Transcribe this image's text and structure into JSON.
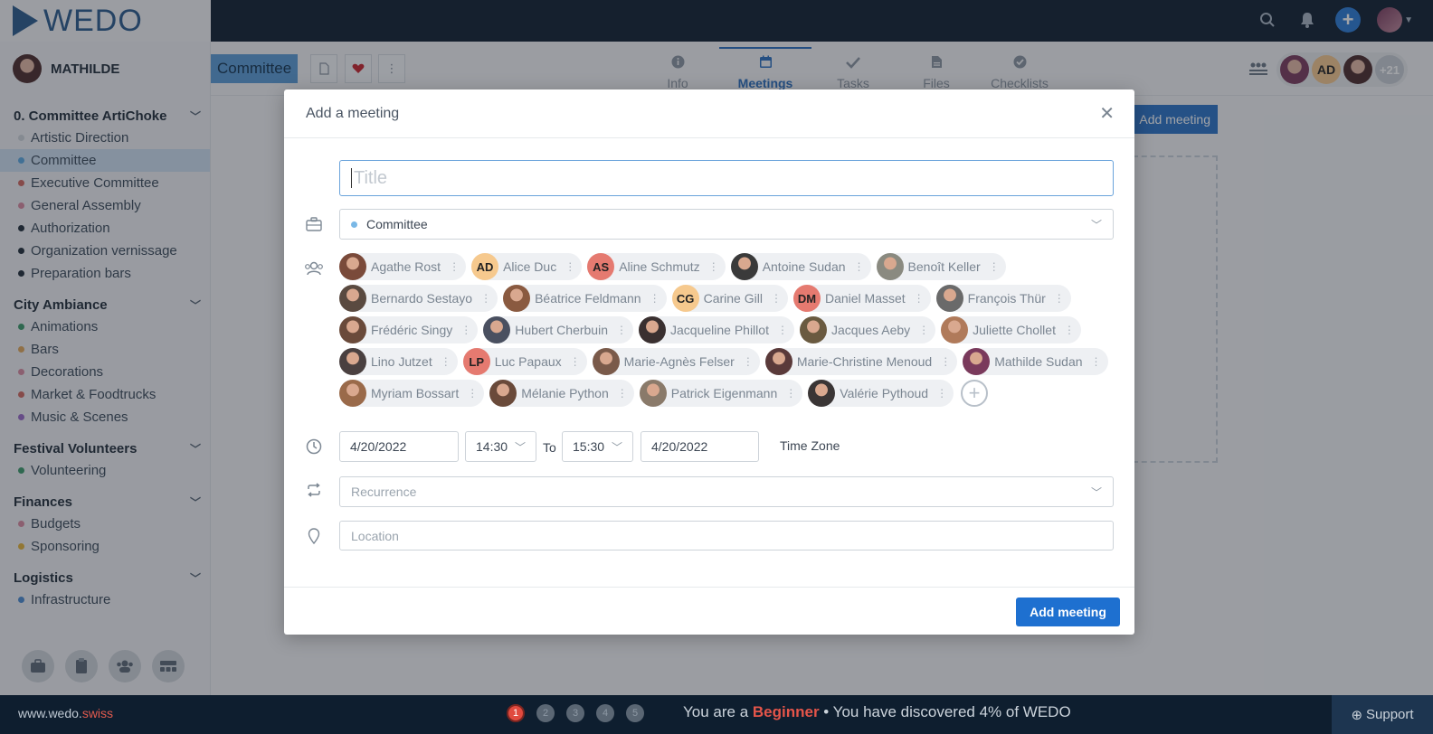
{
  "app": {
    "logo": "WEDO"
  },
  "user": {
    "name": "MATHILDE"
  },
  "sidebar": {
    "groups": [
      {
        "title": "0. Committee ArtiChoke",
        "items": [
          {
            "label": "Artistic Direction",
            "color": "#cfd4da"
          },
          {
            "label": "Committee",
            "color": "#5aa7e0",
            "active": true
          },
          {
            "label": "Executive Committee",
            "color": "#d0685f"
          },
          {
            "label": "General Assembly",
            "color": "#d98aa0"
          },
          {
            "label": "Authorization",
            "color": "#1f2b38"
          },
          {
            "label": "Organization vernissage",
            "color": "#1f2b38"
          },
          {
            "label": "Preparation bars",
            "color": "#1f2b38"
          }
        ]
      },
      {
        "title": "City Ambiance",
        "items": [
          {
            "label": "Animations",
            "color": "#3c9a6a"
          },
          {
            "label": "Bars",
            "color": "#e2a85a"
          },
          {
            "label": "Decorations",
            "color": "#d98aa0"
          },
          {
            "label": "Market & Foodtrucks",
            "color": "#d0685f"
          },
          {
            "label": "Music & Scenes",
            "color": "#9a6ac8"
          }
        ]
      },
      {
        "title": "Festival Volunteers",
        "items": [
          {
            "label": "Volunteering",
            "color": "#3c9a6a"
          }
        ]
      },
      {
        "title": "Finances",
        "items": [
          {
            "label": "Budgets",
            "color": "#d98aa0"
          },
          {
            "label": "Sponsoring",
            "color": "#e6b43a"
          }
        ]
      },
      {
        "title": "Logistics",
        "items": [
          {
            "label": "Infrastructure",
            "color": "#4a8ad0"
          }
        ]
      }
    ]
  },
  "header": {
    "workspace": "Committee",
    "tabs": [
      {
        "label": "Info",
        "icon": "info-icon"
      },
      {
        "label": "Meetings",
        "icon": "calendar-icon",
        "active": true
      },
      {
        "label": "Tasks",
        "icon": "check-icon"
      },
      {
        "label": "Files",
        "icon": "file-icon"
      },
      {
        "label": "Checklists",
        "icon": "checklist-icon"
      }
    ],
    "members_more": "+21",
    "member_initials": "AD"
  },
  "background": {
    "add_meeting_label": "Add meeting"
  },
  "modal": {
    "title": "Add a meeting",
    "title_placeholder": "Title",
    "workspace": "Committee",
    "participants": [
      {
        "name": "Agathe Rost",
        "initials": "",
        "color": "#7a4a3a"
      },
      {
        "name": "Alice Duc",
        "initials": "AD",
        "color": "#f6c98e"
      },
      {
        "name": "Aline Schmutz",
        "initials": "AS",
        "color": "#e57a70"
      },
      {
        "name": "Antoine Sudan",
        "initials": "",
        "color": "#3a3a3a"
      },
      {
        "name": "Benoît Keller",
        "initials": "",
        "color": "#8a8a80"
      },
      {
        "name": "Bernardo Sestayo",
        "initials": "",
        "color": "#5a4a40"
      },
      {
        "name": "Béatrice Feldmann",
        "initials": "",
        "color": "#8a5a40"
      },
      {
        "name": "Carine Gill",
        "initials": "CG",
        "color": "#f6c98e"
      },
      {
        "name": "Daniel Masset",
        "initials": "DM",
        "color": "#e57a70"
      },
      {
        "name": "François Thür",
        "initials": "",
        "color": "#6a6a6a"
      },
      {
        "name": "Frédéric Singy",
        "initials": "",
        "color": "#6a4a3a"
      },
      {
        "name": "Hubert Cherbuin",
        "initials": "",
        "color": "#4a5060"
      },
      {
        "name": "Jacqueline Phillot",
        "initials": "",
        "color": "#3a3030"
      },
      {
        "name": "Jacques Aeby",
        "initials": "",
        "color": "#6a5a40"
      },
      {
        "name": "Juliette Chollet",
        "initials": "",
        "color": "#b07a5a"
      },
      {
        "name": "Lino Jutzet",
        "initials": "",
        "color": "#4a4040"
      },
      {
        "name": "Luc Papaux",
        "initials": "LP",
        "color": "#e57a70"
      },
      {
        "name": "Marie-Agnès Felser",
        "initials": "",
        "color": "#7a5a4a"
      },
      {
        "name": "Marie-Christine Menoud",
        "initials": "",
        "color": "#5a3a3a"
      },
      {
        "name": "Mathilde Sudan",
        "initials": "",
        "color": "#7a3a5c"
      },
      {
        "name": "Myriam Bossart",
        "initials": "",
        "color": "#9a6a4a"
      },
      {
        "name": "Mélanie Python",
        "initials": "",
        "color": "#6a4a3a"
      },
      {
        "name": "Patrick Eigenmann",
        "initials": "",
        "color": "#8a7a6a"
      },
      {
        "name": "Valérie Pythoud",
        "initials": "",
        "color": "#3a3535"
      }
    ],
    "start_date": "4/20/2022",
    "start_time": "14:30",
    "to_label": "To",
    "end_time": "15:30",
    "end_date": "4/20/2022",
    "timezone_label": "Time Zone",
    "recurrence_placeholder": "Recurrence",
    "location_placeholder": "Location",
    "submit_label": "Add meeting"
  },
  "footer": {
    "site_prefix": "www.wedo.",
    "site_suffix": "swiss",
    "steps": [
      "1",
      "2",
      "3",
      "4",
      "5"
    ],
    "progress_prefix": "You are a ",
    "level": "Beginner",
    "progress_suffix": " • You have discovered 4% of WEDO",
    "support": "Support"
  }
}
